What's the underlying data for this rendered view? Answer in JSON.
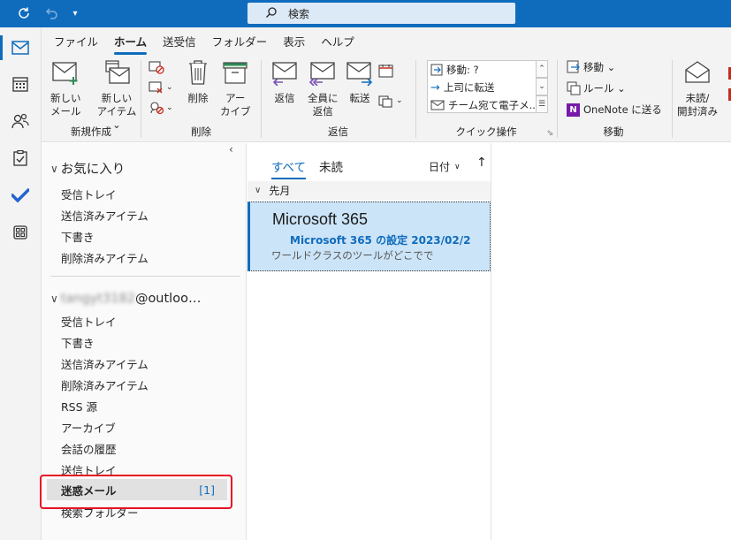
{
  "titlebar": {
    "search_label": "検索",
    "accent": "#0f6cbd"
  },
  "ribbon_tabs": [
    "ファイル",
    "ホーム",
    "送受信",
    "フォルダー",
    "表示",
    "ヘルプ"
  ],
  "ribbon": {
    "new_mail": "新しい\nメール",
    "new_item": "新しい\nアイテム ⌄",
    "group_new": "新規作成",
    "delete": "削除",
    "archive": "アー\nカイブ",
    "group_delete": "削除",
    "reply": "返信",
    "reply_all": "全員に\n返信",
    "forward": "転送",
    "group_respond": "返信",
    "quick_steps": [
      "移動: ?",
      "上司に転送",
      "チーム宛て電子メ..."
    ],
    "group_quick": "クイック操作",
    "move": "移動 ⌄",
    "rules": "ルール ⌄",
    "onenote": "OneNote に送る",
    "group_move": "移動",
    "unread_read": "未読/\n開封済み"
  },
  "folders": {
    "favorites_header": "お気に入り",
    "favorites": [
      "受信トレイ",
      "送信済みアイテム",
      "下書き",
      "削除済みアイテム"
    ],
    "account_blur": "tangyt3182",
    "account_suffix": "@outloo…",
    "account_items": [
      "受信トレイ",
      "下書き",
      "送信済みアイテム",
      "削除済みアイテム",
      "RSS 源",
      "アーカイブ",
      "会話の履歴",
      "送信トレイ"
    ],
    "selected": {
      "name": "迷惑メール",
      "count": "[1]"
    },
    "last": "検索フォルダー"
  },
  "messages": {
    "tab_all": "すべて",
    "tab_unread": "未読",
    "sort": "日付",
    "sort_arrow": "↑",
    "group": "先月",
    "item": {
      "sender": "Microsoft 365",
      "subject": "Microsoft 365 の設定 2023/02/2",
      "preview": "ワールドクラスのツールがどこでで"
    }
  }
}
